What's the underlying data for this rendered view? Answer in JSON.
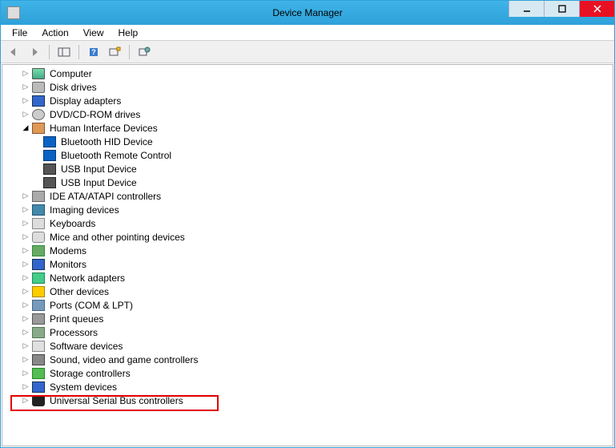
{
  "window": {
    "title": "Device Manager"
  },
  "menu": {
    "file": "File",
    "action": "Action",
    "view": "View",
    "help": "Help"
  },
  "tree": {
    "computer": "Computer",
    "disk_drives": "Disk drives",
    "display_adapters": "Display adapters",
    "dvd": "DVD/CD-ROM drives",
    "hid": "Human Interface Devices",
    "hid_children": {
      "bt_hid": "Bluetooth HID Device",
      "bt_remote": "Bluetooth Remote Control",
      "usb_input_1": "USB Input Device",
      "usb_input_2": "USB Input Device"
    },
    "ide": "IDE ATA/ATAPI controllers",
    "imaging": "Imaging devices",
    "keyboards": "Keyboards",
    "mice": "Mice and other pointing devices",
    "modems": "Modems",
    "monitors": "Monitors",
    "network": "Network adapters",
    "other": "Other devices",
    "ports": "Ports (COM & LPT)",
    "print": "Print queues",
    "processors": "Processors",
    "software": "Software devices",
    "sound": "Sound, video and game controllers",
    "storage": "Storage controllers",
    "system": "System devices",
    "usb": "Universal Serial Bus controllers"
  }
}
